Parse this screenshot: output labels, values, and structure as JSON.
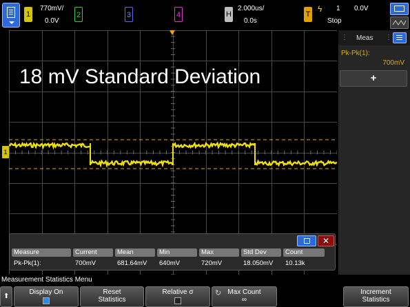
{
  "topbar": {
    "ch1": {
      "num": "1",
      "scale": "770mV/",
      "offset": "0.0V",
      "color": "#d4c40e"
    },
    "ch2": {
      "num": "2",
      "color": "#2bd42b"
    },
    "ch3": {
      "num": "3",
      "color": "#5b6cf0"
    },
    "ch4": {
      "num": "4",
      "color": "#e235d6"
    },
    "horizontal": {
      "label": "H",
      "timebase": "2.000us/",
      "delay": "0.0s"
    },
    "trigger": {
      "label": "T",
      "source": "1",
      "level": "0.0V",
      "mode": "Stop",
      "trig_icon": "lightning-icon"
    }
  },
  "side_panel": {
    "title": "Meas",
    "measurement_label": "Pk-Pk(1):",
    "measurement_value": "700mV",
    "add_label": "+"
  },
  "screen": {
    "annotation": "18 mV Standard Deviation",
    "ground_marker": "1"
  },
  "stats_table": {
    "headers": [
      "Measure",
      "Current",
      "Mean",
      "Min",
      "Max",
      "Std Dev",
      "Count"
    ],
    "row": [
      "Pk-Pk(1):",
      "700mV",
      "681.64mV",
      "640mV",
      "720mV",
      "18.050mV",
      "10.13k"
    ]
  },
  "bottom": {
    "menu_title": "Measurement Statistics Menu",
    "keys": [
      {
        "label": "Display On"
      },
      {
        "label": "Reset",
        "label2": "Statistics"
      },
      {
        "label": "Relative σ"
      },
      {
        "label": "Max Count",
        "value": "∞"
      },
      {
        "label": "Increment",
        "label2": "Statistics"
      }
    ]
  },
  "colors": {
    "trace": "#f3e100",
    "grid": "#4a4a4a",
    "accent": "#2b6ad8",
    "cursor": "#f0a020"
  }
}
